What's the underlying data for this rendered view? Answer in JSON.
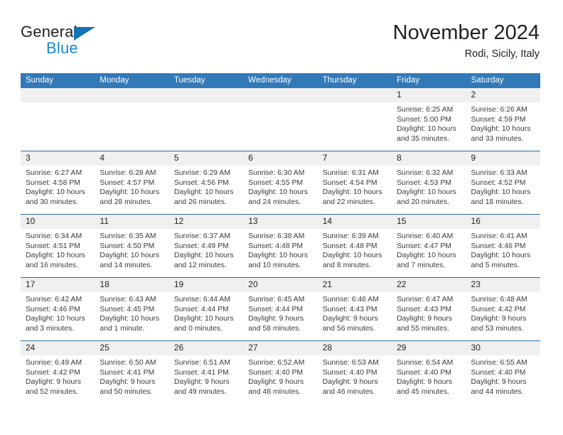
{
  "brand": {
    "name_part1": "General",
    "name_part2": "Blue",
    "accent_color": "#1b87d6",
    "triangle_color": "#1272b6"
  },
  "header": {
    "title": "November 2024",
    "subtitle": "Rodi, Sicily, Italy"
  },
  "theme": {
    "header_bg": "#3279b8",
    "header_text": "#ffffff",
    "row_border": "#2e6da4",
    "daynum_bg": "#f0f0f0"
  },
  "weekdays": [
    "Sunday",
    "Monday",
    "Tuesday",
    "Wednesday",
    "Thursday",
    "Friday",
    "Saturday"
  ],
  "weeks": [
    [
      {
        "day": "",
        "empty": true
      },
      {
        "day": "",
        "empty": true
      },
      {
        "day": "",
        "empty": true
      },
      {
        "day": "",
        "empty": true
      },
      {
        "day": "",
        "empty": true
      },
      {
        "day": "1",
        "sunrise": "Sunrise: 6:25 AM",
        "sunset": "Sunset: 5:00 PM",
        "daylight": "Daylight: 10 hours and 35 minutes."
      },
      {
        "day": "2",
        "sunrise": "Sunrise: 6:26 AM",
        "sunset": "Sunset: 4:59 PM",
        "daylight": "Daylight: 10 hours and 33 minutes."
      }
    ],
    [
      {
        "day": "3",
        "sunrise": "Sunrise: 6:27 AM",
        "sunset": "Sunset: 4:58 PM",
        "daylight": "Daylight: 10 hours and 30 minutes."
      },
      {
        "day": "4",
        "sunrise": "Sunrise: 6:28 AM",
        "sunset": "Sunset: 4:57 PM",
        "daylight": "Daylight: 10 hours and 28 minutes."
      },
      {
        "day": "5",
        "sunrise": "Sunrise: 6:29 AM",
        "sunset": "Sunset: 4:56 PM",
        "daylight": "Daylight: 10 hours and 26 minutes."
      },
      {
        "day": "6",
        "sunrise": "Sunrise: 6:30 AM",
        "sunset": "Sunset: 4:55 PM",
        "daylight": "Daylight: 10 hours and 24 minutes."
      },
      {
        "day": "7",
        "sunrise": "Sunrise: 6:31 AM",
        "sunset": "Sunset: 4:54 PM",
        "daylight": "Daylight: 10 hours and 22 minutes."
      },
      {
        "day": "8",
        "sunrise": "Sunrise: 6:32 AM",
        "sunset": "Sunset: 4:53 PM",
        "daylight": "Daylight: 10 hours and 20 minutes."
      },
      {
        "day": "9",
        "sunrise": "Sunrise: 6:33 AM",
        "sunset": "Sunset: 4:52 PM",
        "daylight": "Daylight: 10 hours and 18 minutes."
      }
    ],
    [
      {
        "day": "10",
        "sunrise": "Sunrise: 6:34 AM",
        "sunset": "Sunset: 4:51 PM",
        "daylight": "Daylight: 10 hours and 16 minutes."
      },
      {
        "day": "11",
        "sunrise": "Sunrise: 6:35 AM",
        "sunset": "Sunset: 4:50 PM",
        "daylight": "Daylight: 10 hours and 14 minutes."
      },
      {
        "day": "12",
        "sunrise": "Sunrise: 6:37 AM",
        "sunset": "Sunset: 4:49 PM",
        "daylight": "Daylight: 10 hours and 12 minutes."
      },
      {
        "day": "13",
        "sunrise": "Sunrise: 6:38 AM",
        "sunset": "Sunset: 4:48 PM",
        "daylight": "Daylight: 10 hours and 10 minutes."
      },
      {
        "day": "14",
        "sunrise": "Sunrise: 6:39 AM",
        "sunset": "Sunset: 4:48 PM",
        "daylight": "Daylight: 10 hours and 8 minutes."
      },
      {
        "day": "15",
        "sunrise": "Sunrise: 6:40 AM",
        "sunset": "Sunset: 4:47 PM",
        "daylight": "Daylight: 10 hours and 7 minutes."
      },
      {
        "day": "16",
        "sunrise": "Sunrise: 6:41 AM",
        "sunset": "Sunset: 4:46 PM",
        "daylight": "Daylight: 10 hours and 5 minutes."
      }
    ],
    [
      {
        "day": "17",
        "sunrise": "Sunrise: 6:42 AM",
        "sunset": "Sunset: 4:46 PM",
        "daylight": "Daylight: 10 hours and 3 minutes."
      },
      {
        "day": "18",
        "sunrise": "Sunrise: 6:43 AM",
        "sunset": "Sunset: 4:45 PM",
        "daylight": "Daylight: 10 hours and 1 minute."
      },
      {
        "day": "19",
        "sunrise": "Sunrise: 6:44 AM",
        "sunset": "Sunset: 4:44 PM",
        "daylight": "Daylight: 10 hours and 0 minutes."
      },
      {
        "day": "20",
        "sunrise": "Sunrise: 6:45 AM",
        "sunset": "Sunset: 4:44 PM",
        "daylight": "Daylight: 9 hours and 58 minutes."
      },
      {
        "day": "21",
        "sunrise": "Sunrise: 6:46 AM",
        "sunset": "Sunset: 4:43 PM",
        "daylight": "Daylight: 9 hours and 56 minutes."
      },
      {
        "day": "22",
        "sunrise": "Sunrise: 6:47 AM",
        "sunset": "Sunset: 4:43 PM",
        "daylight": "Daylight: 9 hours and 55 minutes."
      },
      {
        "day": "23",
        "sunrise": "Sunrise: 6:48 AM",
        "sunset": "Sunset: 4:42 PM",
        "daylight": "Daylight: 9 hours and 53 minutes."
      }
    ],
    [
      {
        "day": "24",
        "sunrise": "Sunrise: 6:49 AM",
        "sunset": "Sunset: 4:42 PM",
        "daylight": "Daylight: 9 hours and 52 minutes."
      },
      {
        "day": "25",
        "sunrise": "Sunrise: 6:50 AM",
        "sunset": "Sunset: 4:41 PM",
        "daylight": "Daylight: 9 hours and 50 minutes."
      },
      {
        "day": "26",
        "sunrise": "Sunrise: 6:51 AM",
        "sunset": "Sunset: 4:41 PM",
        "daylight": "Daylight: 9 hours and 49 minutes."
      },
      {
        "day": "27",
        "sunrise": "Sunrise: 6:52 AM",
        "sunset": "Sunset: 4:40 PM",
        "daylight": "Daylight: 9 hours and 48 minutes."
      },
      {
        "day": "28",
        "sunrise": "Sunrise: 6:53 AM",
        "sunset": "Sunset: 4:40 PM",
        "daylight": "Daylight: 9 hours and 46 minutes."
      },
      {
        "day": "29",
        "sunrise": "Sunrise: 6:54 AM",
        "sunset": "Sunset: 4:40 PM",
        "daylight": "Daylight: 9 hours and 45 minutes."
      },
      {
        "day": "30",
        "sunrise": "Sunrise: 6:55 AM",
        "sunset": "Sunset: 4:40 PM",
        "daylight": "Daylight: 9 hours and 44 minutes."
      }
    ]
  ]
}
